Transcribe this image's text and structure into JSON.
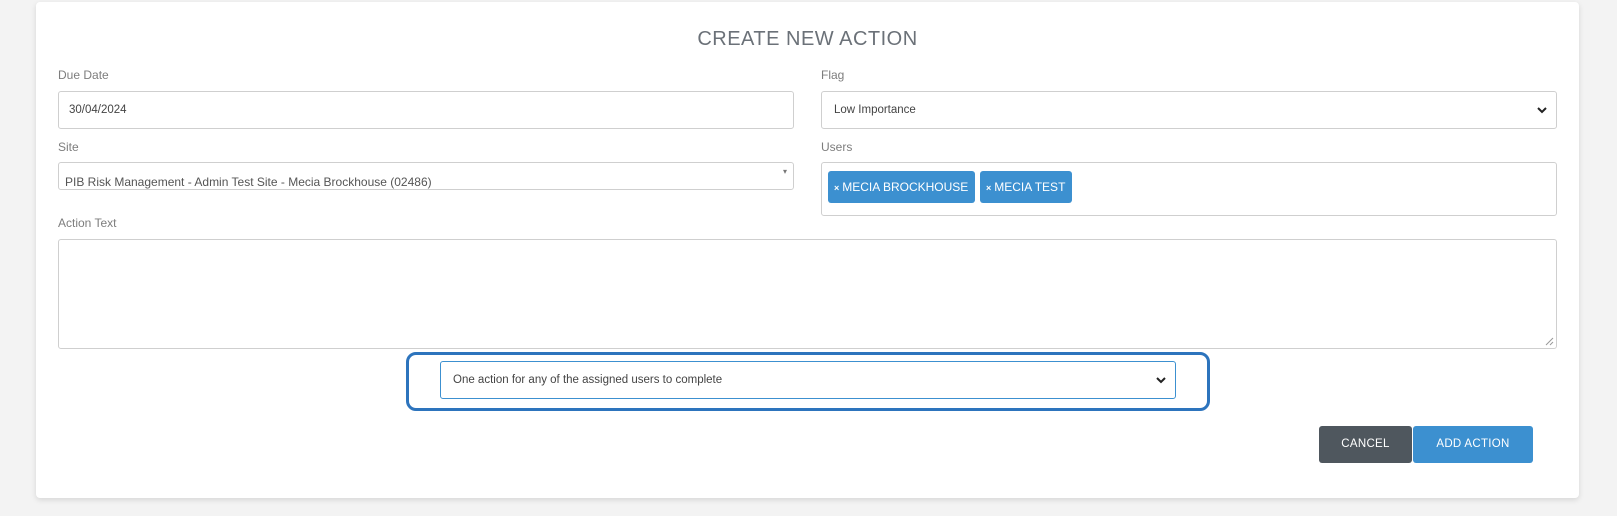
{
  "dialog": {
    "title": "CREATE NEW ACTION"
  },
  "due_date": {
    "label": "Due Date",
    "value": "30/04/2024"
  },
  "flag": {
    "label": "Flag",
    "selected": "Low Importance",
    "icon": "chevron-down-icon"
  },
  "site": {
    "label": "Site",
    "selected": "PIB Risk Management - Admin Test Site - Mecia Brockhouse (02486)"
  },
  "users": {
    "label": "Users",
    "tags": [
      {
        "remove": "×",
        "name": "MECIA BROCKHOUSE"
      },
      {
        "remove": "×",
        "name": "MECIA TEST"
      }
    ]
  },
  "action_text": {
    "label": "Action Text",
    "value": ""
  },
  "assignment_mode": {
    "selected": "One action for any of the assigned users to complete",
    "icon": "chevron-down-icon"
  },
  "buttons": {
    "cancel": "CANCEL",
    "add_action": "ADD ACTION"
  },
  "colors": {
    "accent": "#3c90d0",
    "cancel_bg": "#4f575e",
    "highlight": "#2d74bd"
  }
}
